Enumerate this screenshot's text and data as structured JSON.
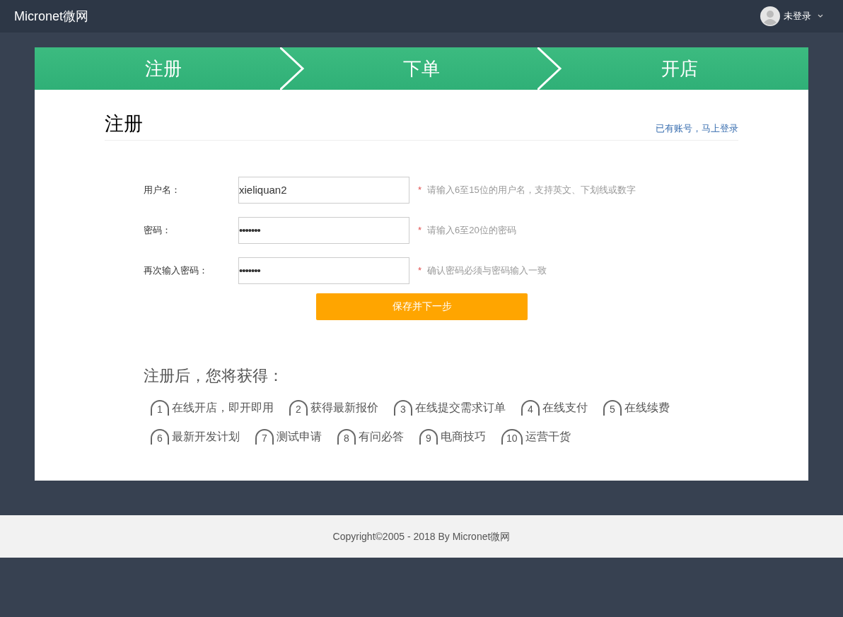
{
  "header": {
    "logo": "Micronet微网",
    "user": "未登录"
  },
  "steps": [
    "注册",
    "下单",
    "开店"
  ],
  "form": {
    "title": "注册",
    "login_link": "已有账号，马上登录",
    "fields": [
      {
        "label": "用户名：",
        "value": "xieliquan2",
        "kind": "text",
        "required_mark": "*",
        "hint": "请输入6至15位的用户名，支持英文、下划线或数字"
      },
      {
        "label": "密码：",
        "value": "•••••••",
        "kind": "password",
        "required_mark": "*",
        "hint": "请输入6至20位的密码"
      },
      {
        "label": "再次输入密码：",
        "value": "•••••••",
        "kind": "password",
        "required_mark": "*",
        "hint": "确认密码必须与密码输入一致"
      }
    ],
    "submit": "保存并下一步"
  },
  "benefits": {
    "title": "注册后，您将获得：",
    "items": [
      {
        "number": "1",
        "text": "在线开店，即开即用"
      },
      {
        "number": "2",
        "text": "获得最新报价"
      },
      {
        "number": "3",
        "text": "在线提交需求订单"
      },
      {
        "number": "4",
        "text": "在线支付"
      },
      {
        "number": "5",
        "text": "在线续费"
      },
      {
        "number": "6",
        "text": "最新开发计划"
      },
      {
        "number": "7",
        "text": "测试申请"
      },
      {
        "number": "8",
        "text": "有问必答"
      },
      {
        "number": "9",
        "text": "电商技巧"
      },
      {
        "number": "10",
        "text": "运营干货"
      }
    ]
  },
  "footer": "Copyright©2005 - 2018 By Micronet微网"
}
